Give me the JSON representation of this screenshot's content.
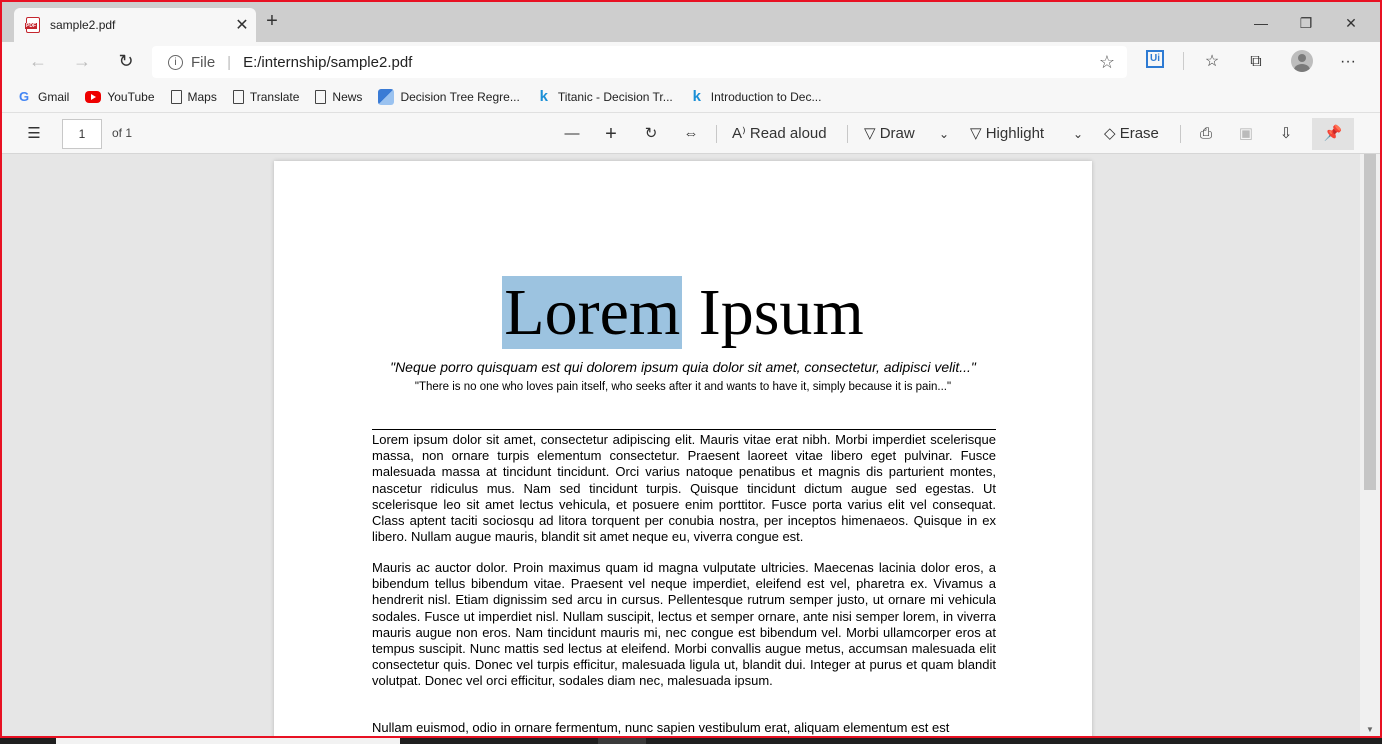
{
  "tab": {
    "title": "sample2.pdf",
    "close": "✕"
  },
  "newtab": "+",
  "window": {
    "minimize": "—",
    "restore": "❐",
    "close": "✕"
  },
  "address": {
    "scheme_label": "File",
    "url": "E:/internship/sample2.pdf"
  },
  "favorites": [
    {
      "label": "Gmail",
      "icon": "google-icon"
    },
    {
      "label": "YouTube",
      "icon": "youtube-icon"
    },
    {
      "label": "Maps",
      "icon": "page-icon"
    },
    {
      "label": "Translate",
      "icon": "page-icon"
    },
    {
      "label": "News",
      "icon": "page-icon"
    },
    {
      "label": "Decision Tree Regre...",
      "icon": "decision-tree-icon"
    },
    {
      "label": "Titanic - Decision Tr...",
      "icon": "kaggle-icon"
    },
    {
      "label": "Introduction to Dec...",
      "icon": "kaggle-icon"
    }
  ],
  "pdf_toolbar": {
    "page_number": "1",
    "page_total": "of 1",
    "read_aloud": "Read aloud",
    "draw": "Draw",
    "highlight": "Highlight",
    "erase": "Erase"
  },
  "document": {
    "title_highlighted": "Lorem",
    "title_rest": " Ipsum",
    "quote_latin": "\"Neque porro quisquam est qui dolorem ipsum quia dolor sit amet, consectetur, adipisci velit...\"",
    "quote_english": "\"There is no one who loves pain itself, who seeks after it and wants to have it, simply because it is pain...\"",
    "paragraphs": [
      "Lorem ipsum dolor sit amet, consectetur adipiscing elit. Mauris vitae erat nibh. Morbi imperdiet scelerisque massa, non ornare turpis elementum consectetur. Praesent laoreet vitae libero eget pulvinar. Fusce malesuada massa at tincidunt tincidunt. Orci varius natoque penatibus et magnis dis parturient montes, nascetur ridiculus mus. Nam sed tincidunt turpis. Quisque tincidunt dictum augue sed egestas. Ut scelerisque leo sit amet lectus vehicula, et posuere enim porttitor. Fusce porta varius elit vel consequat. Class aptent taciti sociosqu ad litora torquent per conubia nostra, per inceptos himenaeos. Quisque in ex libero. Nullam augue mauris, blandit sit amet neque eu, viverra congue est.",
      "Mauris ac auctor dolor. Proin maximus quam id magna vulputate ultricies. Maecenas lacinia dolor eros, a bibendum tellus bibendum vitae. Praesent vel neque imperdiet, eleifend est vel, pharetra ex. Vivamus a hendrerit nisl. Etiam dignissim sed arcu in cursus. Pellentesque rutrum semper justo, ut ornare mi vehicula sodales. Fusce ut imperdiet nisl. Nullam suscipit, lectus et semper ornare, ante nisi semper lorem, in viverra mauris augue non eros. Nam tincidunt mauris mi, nec congue est bibendum vel. Morbi ullamcorper eros at tempus suscipit. Nunc mattis sed lectus at eleifend. Morbi convallis augue metus, accumsan malesuada elit consectetur quis. Donec vel turpis efficitur, malesuada ligula ut, blandit dui. Integer at purus et quam blandit volutpat. Donec vel orci efficitur, sodales diam nec, malesuada ipsum.",
      "Nullam euismod, odio in ornare fermentum, nunc sapien vestibulum erat, aliquam elementum est est"
    ]
  },
  "colors": {
    "selection_highlight": "#9cc3e0",
    "window_border": "#e81123",
    "pdf_icon": "#c4262e"
  }
}
